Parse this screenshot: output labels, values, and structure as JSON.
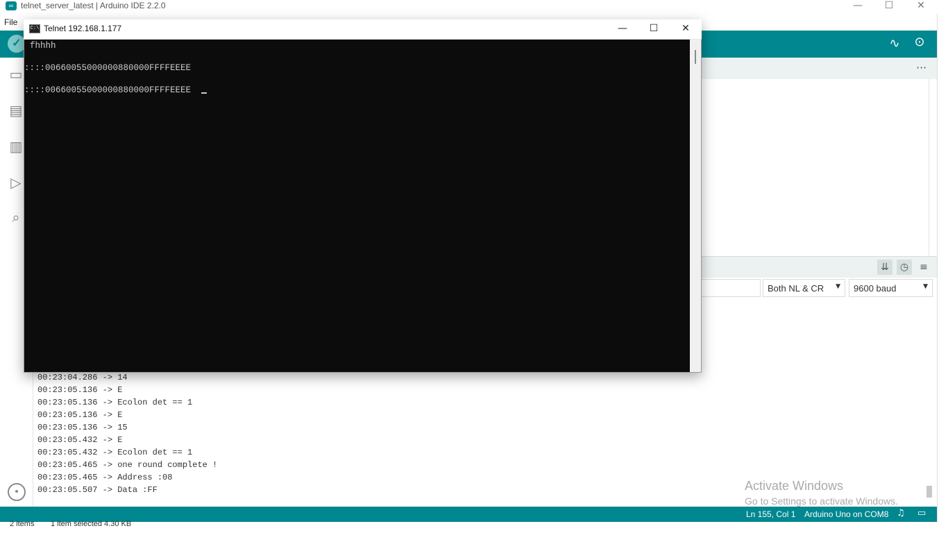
{
  "ide": {
    "window_title": "telnet_server_latest | Arduino IDE 2.2.0",
    "logo_icon": "arduino-logo-icon",
    "menu": {
      "file": "File"
    },
    "toolbar": {
      "verify_icon": "check-icon",
      "verify_glyph": "✓",
      "plotter_icon": "serial-plotter-icon",
      "monitor_icon": "serial-monitor-icon"
    },
    "editor": {
      "more_glyph": "···"
    },
    "serial_monitor": {
      "line_ending": "Both NL & CR",
      "baud": "9600 baud",
      "lines": [
        "00:23:04.286 -> 14",
        "00:23:05.136 -> E",
        "00:23:05.136 -> Ecolon det == 1",
        "00:23:05.136 -> E",
        "00:23:05.136 -> 15",
        "00:23:05.432 -> E",
        "00:23:05.432 -> Ecolon det == 1",
        "00:23:05.465 -> one round complete !",
        "00:23:05.465 -> Address :08",
        "00:23:05.507 -> Data :FF"
      ]
    },
    "statusbar": {
      "position": "Ln 155, Col 1",
      "board": "Arduino Uno on COM8"
    }
  },
  "watermark": {
    "title": "Activate Windows",
    "subtitle": "Go to Settings to activate Windows."
  },
  "explorer": {
    "items": "2 items",
    "selected": "1 item selected  4.30 KB"
  },
  "telnet": {
    "title": "Telnet 192.168.1.177",
    "console_lines": [
      "fhhhh",
      "::::00660055000000880000FFFFEEEE",
      "::::00660055000000880000FFFFEEEE"
    ]
  },
  "colors": {
    "accent": "#00878f",
    "console_bg": "#0c0c0c",
    "console_text": "#cccccc"
  }
}
